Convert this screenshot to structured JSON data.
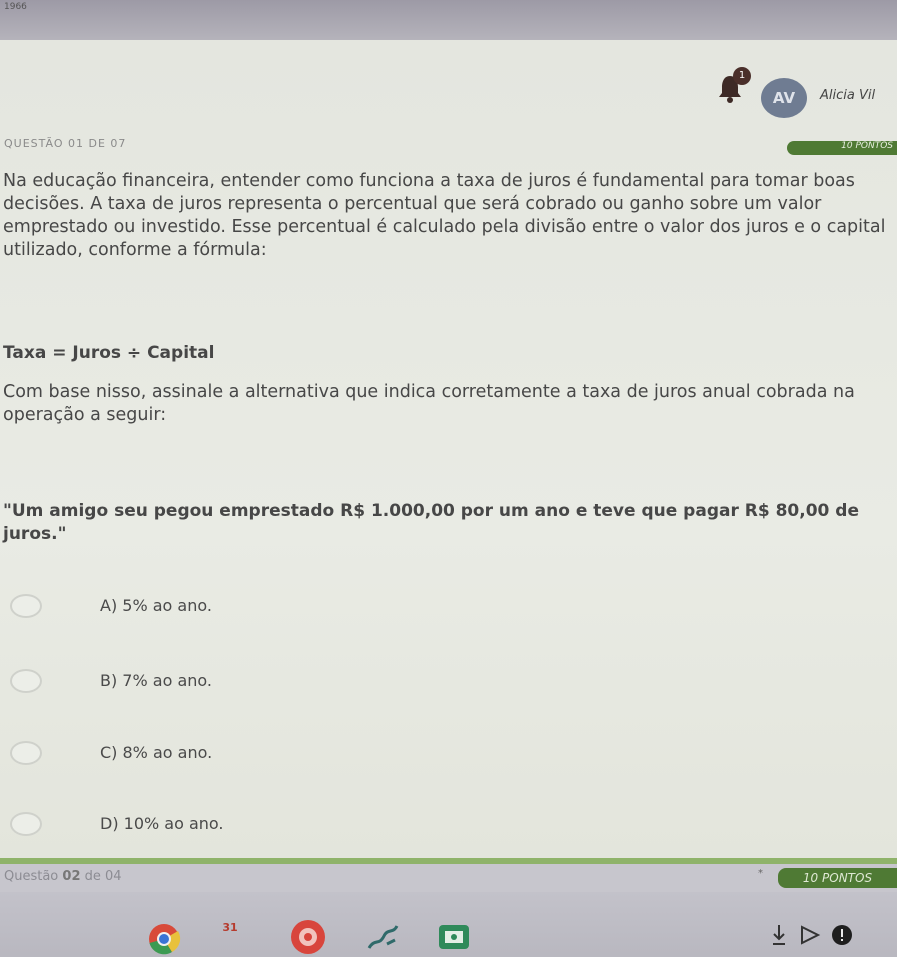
{
  "browser": {
    "corner_text": "1966"
  },
  "header": {
    "notification_count": "1",
    "avatar_initials": "AV",
    "user_name": "Alicia Vil"
  },
  "question": {
    "number_label": "QUESTÃO 01 DE 07",
    "points_label": "10 PONTOS",
    "paragraph": "Na educação financeira, entender como funciona a taxa de juros é fundamental para tomar boas decisões. A taxa de juros representa o percentual que será cobrado ou ganho sobre um valor emprestado ou investido. Esse percentual é calculado pela divisão entre o valor dos juros e o capital utilizado, conforme a fórmula:",
    "formula": "Taxa = Juros ÷ Capital",
    "instruction": "Com base nisso, assinale a alternativa que indica corretamente a taxa de juros anual cobrada na operação a seguir:",
    "quote": "\"Um amigo seu pegou emprestado R$ 1.000,00 por um ano e teve que pagar R$ 80,00 de juros.\"",
    "options": [
      {
        "label": "A) 5% ao ano."
      },
      {
        "label": "B) 7% ao ano."
      },
      {
        "label": "C) 8% ao ano."
      },
      {
        "label": "D) 10% ao ano."
      }
    ]
  },
  "next_question": {
    "label_prefix": "Questão ",
    "number": "02",
    "label_suffix": " de 04",
    "star": "*",
    "points_label": "10 PONTOS"
  },
  "colors": {
    "accent_green": "#4f7a34",
    "card_bg": "#e8eae3"
  },
  "taskbar": {
    "icons": [
      "chrome-icon",
      "calendar-icon",
      "photos-icon",
      "draw-icon",
      "classroom-icon"
    ],
    "tray": [
      "download-icon",
      "play-icon",
      "status-icon"
    ],
    "calendar_text": "31"
  }
}
